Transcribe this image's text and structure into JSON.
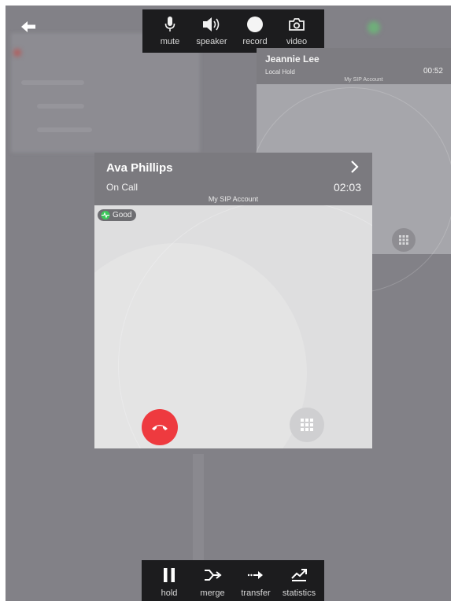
{
  "top_toolbar": {
    "items": [
      {
        "icon": "microphone-icon",
        "label": "mute"
      },
      {
        "icon": "speaker-icon",
        "label": "speaker"
      },
      {
        "icon": "record-icon",
        "label": "record"
      },
      {
        "icon": "camera-icon",
        "label": "video"
      }
    ]
  },
  "bottom_toolbar": {
    "items": [
      {
        "icon": "pause-icon",
        "label": "hold"
      },
      {
        "icon": "merge-icon",
        "label": "merge"
      },
      {
        "icon": "transfer-icon",
        "label": "transfer"
      },
      {
        "icon": "statistics-icon",
        "label": "statistics"
      }
    ]
  },
  "active_call": {
    "name": "Ava Phillips",
    "status": "On Call",
    "duration": "02:03",
    "account": "My SIP Account",
    "quality": "Good"
  },
  "held_call": {
    "name": "Jeannie Lee",
    "status": "Local Hold",
    "duration": "00:52",
    "account": "My SIP Account"
  },
  "colors": {
    "hangup": "#ee3a3f",
    "quality_good": "#3cc85a",
    "toolbar": "#1c1c1e"
  }
}
